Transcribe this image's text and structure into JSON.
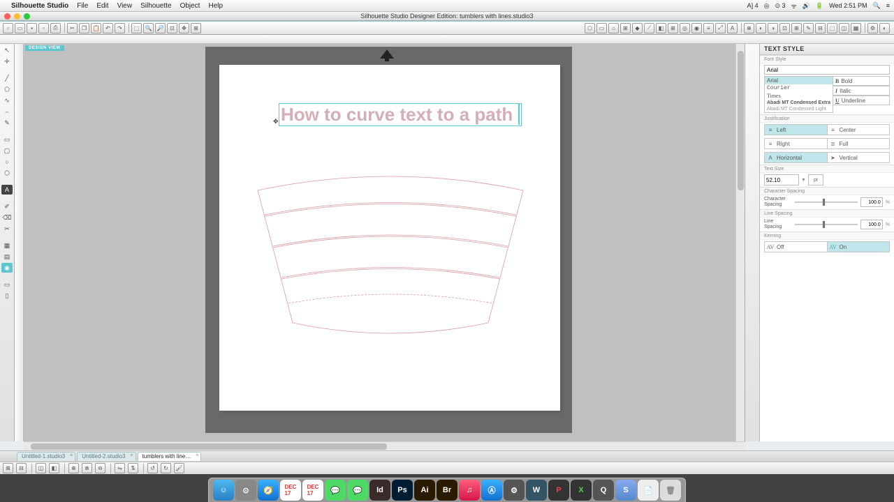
{
  "mac": {
    "app_name": "Silhouette Studio",
    "menus": [
      "File",
      "Edit",
      "View",
      "Silhouette",
      "Object",
      "Help"
    ],
    "clock": "Wed 2:51 PM"
  },
  "window": {
    "title": "Silhouette Studio Designer Edition: tumblers with lines.studio3"
  },
  "canvas": {
    "design_label": "DESIGN VIEW",
    "text_object": "How to curve text to a path"
  },
  "tabs": [
    {
      "label": "Untitled-1.studio3",
      "active": false
    },
    {
      "label": "Untitled-2.studio3",
      "active": false
    },
    {
      "label": "tumblers with line…",
      "active": true
    }
  ],
  "panel": {
    "title": "TEXT STYLE",
    "section_font_style": "Font Style",
    "font_name": "Arial",
    "font_list": [
      "Arial",
      "Courier",
      "Times",
      "Abadi MT Condensed Extra",
      "Abadi MT Condensed Light"
    ],
    "bold": "Bold",
    "italic": "Italic",
    "underline": "Underline",
    "section_justification": "Justification",
    "just_left": "Left",
    "just_center": "Center",
    "just_right": "Right",
    "just_full": "Full",
    "horizontal": "Horizontal",
    "vertical": "Vertical",
    "section_text_size": "Text Size",
    "size_value": "52.10",
    "size_unit": "pt",
    "section_char_spacing": "Character Spacing",
    "char_spacing_label": "Character Spacing",
    "char_spacing_val": "100.0",
    "section_line_spacing": "Line Spacing",
    "line_spacing_label": "Line Spacing",
    "line_spacing_val": "100.0",
    "section_kerning": "Kerning",
    "kern_off": "Off",
    "kern_on": "On",
    "pct": "%"
  },
  "dock": {
    "apps": [
      "Finder",
      "Safari",
      "Compass",
      "Cal",
      "Cal2",
      "Msg",
      "Msg2",
      "Id",
      "Ps",
      "Ai",
      "Br",
      "iTunes",
      "App",
      "Sys",
      "W",
      "P",
      "X",
      "Q",
      "S",
      "Pages",
      "Trash"
    ]
  }
}
